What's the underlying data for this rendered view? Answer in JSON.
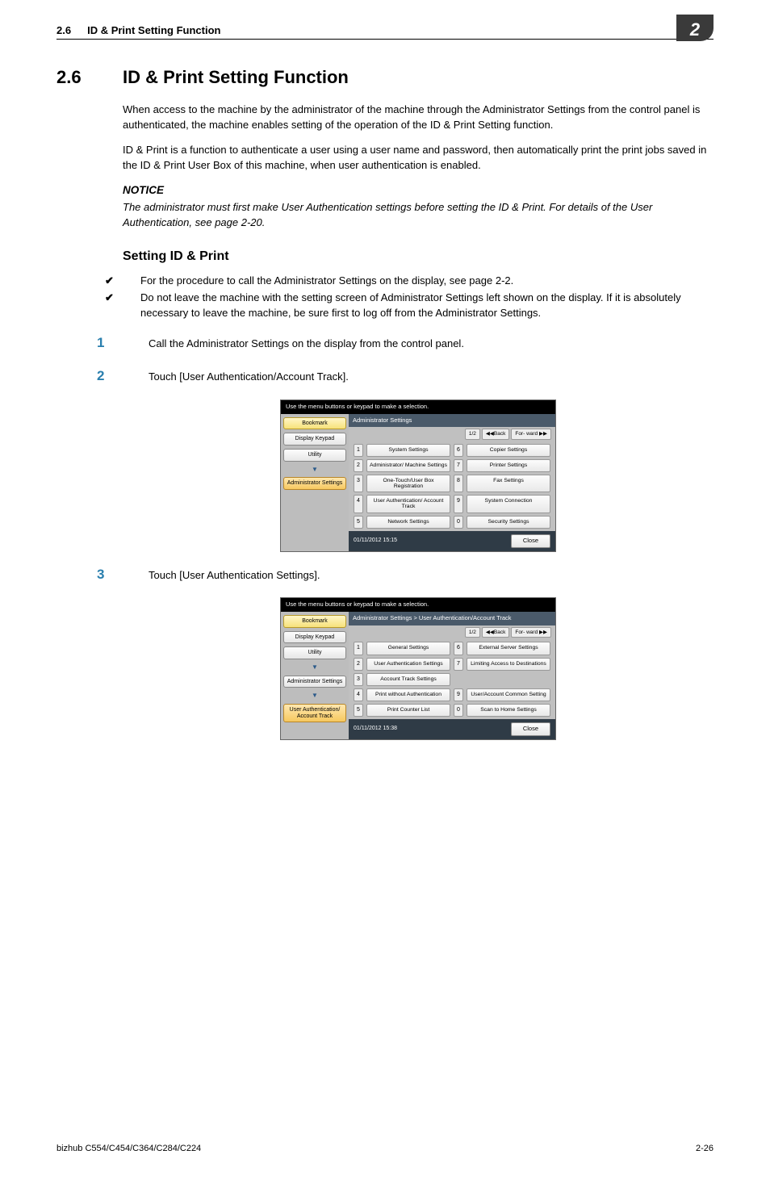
{
  "header": {
    "section_no": "2.6",
    "section_title": "ID & Print Setting Function",
    "chapter_no": "2"
  },
  "title": {
    "no": "2.6",
    "text": "ID & Print Setting Function"
  },
  "intro": {
    "p1": "When access to the machine by the administrator of the machine through the Administrator Settings from the control panel is authenticated, the machine enables setting of the operation of the ID & Print Setting function.",
    "p2": "ID & Print is a function to authenticate a user using a user name and password, then automatically print the print jobs saved in the ID & Print User Box of this machine, when user authentication is enabled."
  },
  "notice": {
    "label": "NOTICE",
    "text": "The administrator must first make User Authentication settings before setting the ID & Print. For details of the User Authentication, see page 2-20."
  },
  "sub": "Setting ID & Print",
  "checks": {
    "c1": "For the procedure to call the Administrator Settings on the display, see page 2-2.",
    "c2": "Do not leave the machine with the setting screen of Administrator Settings left shown on the display. If it is absolutely necessary to leave the machine, be sure first to log off from the Administrator Settings."
  },
  "steps": {
    "s1": "Call the Administrator Settings on the display from the control panel.",
    "s2": "Touch [User Authentication/Account Track].",
    "s3": "Touch [User Authentication Settings]."
  },
  "screens": {
    "hint": "Use the menu buttons or keypad to make a selection.",
    "side": {
      "bookmark": "Bookmark",
      "keypad": "Display Keypad",
      "utility": "Utility",
      "admin": "Administrator Settings",
      "uauth": "User Authentication/ Account Track"
    },
    "pager": {
      "page": "1/2",
      "back": "◀◀Back",
      "fwd": "For- ward ▶▶"
    },
    "scr1": {
      "title": "Administrator Settings",
      "items_left": [
        "System Settings",
        "Administrator/ Machine Settings",
        "One-Touch/User Box Registration",
        "User Authentication/ Account Track",
        "Network Settings"
      ],
      "items_right": [
        "Copier Settings",
        "Printer Settings",
        "Fax Settings",
        "System Connection",
        "Security Settings"
      ],
      "time": "01/11/2012   15:15"
    },
    "scr2": {
      "title": "Administrator Settings > User Authentication/Account Track",
      "items_left": [
        "General Settings",
        "User Authentication Settings",
        "Account Track Settings",
        "Print without Authentication",
        "Print Counter List"
      ],
      "items_right": [
        "External Server Settings",
        "Limiting Access to Destinations",
        "",
        "User/Account Common Setting",
        "Scan to Home Settings"
      ],
      "time": "01/11/2012   15:38"
    },
    "close": "Close"
  },
  "footer": {
    "left": "bizhub C554/C454/C364/C284/C224",
    "right": "2-26"
  }
}
